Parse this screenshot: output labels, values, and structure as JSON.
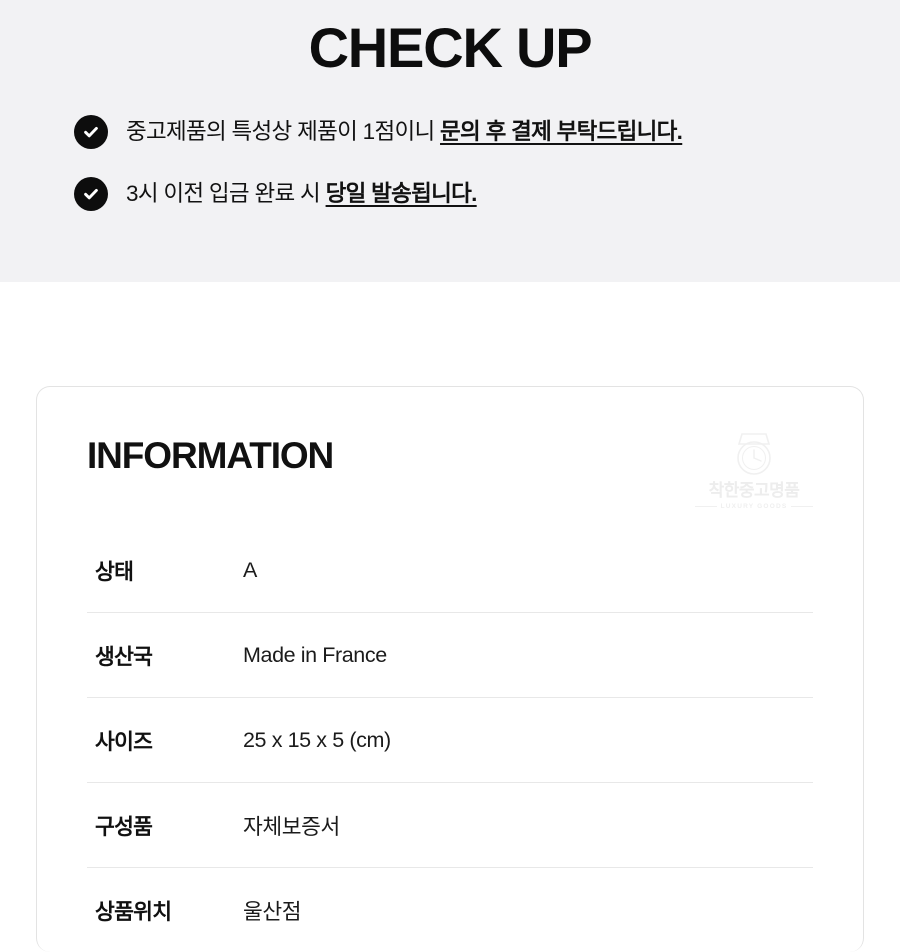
{
  "banner": {
    "title": "CHECK UP",
    "background_color": "#f2f2f4",
    "bullets": [
      {
        "icon": "check-circle-icon",
        "lead": "중고제품의 특성상 제품이 1점이니 ",
        "emphasis": "문의 후 결제 부탁드립니다."
      },
      {
        "icon": "check-circle-icon",
        "lead": "3시 이전 입금 완료 시 ",
        "emphasis": "당일 발송됩니다."
      }
    ]
  },
  "information": {
    "title": "INFORMATION",
    "watermark": {
      "icon": "watch-logo-icon",
      "brand": "착한중고명품",
      "subtitle": "LUXURY GOODS"
    },
    "rows": [
      {
        "label": "상태",
        "value": "A"
      },
      {
        "label": "생산국",
        "value": "Made in France"
      },
      {
        "label": "사이즈",
        "value": "25 x 15 x 5 (cm)"
      },
      {
        "label": "구성품",
        "value": "자체보증서"
      },
      {
        "label": "상품위치",
        "value": "울산점"
      }
    ]
  },
  "colors": {
    "text": "#111111",
    "band_bg": "#f2f2f4",
    "card_border": "#e3e3e3",
    "divider": "#e8e8e8",
    "icon_bg": "#0d0d0d",
    "watermark": "#ededed"
  }
}
